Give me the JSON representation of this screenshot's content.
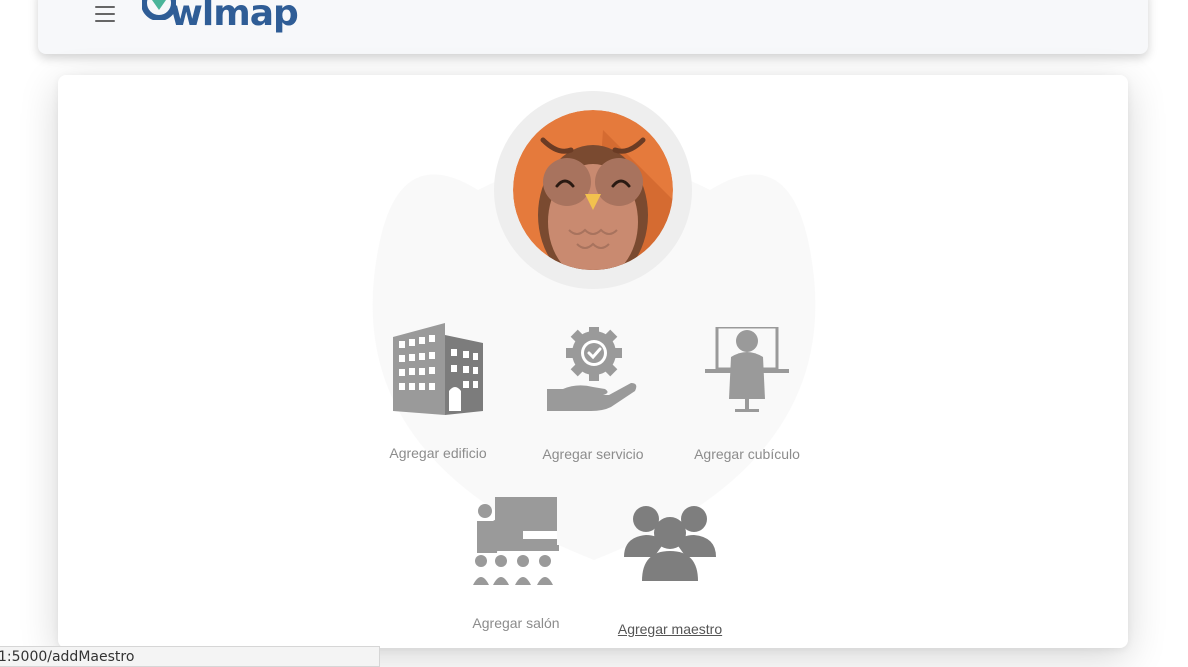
{
  "header": {
    "brand": "Owlmap",
    "menu_icon": "hamburger-icon"
  },
  "actions": [
    {
      "label": "Agregar edificio",
      "icon": "building-icon"
    },
    {
      "label": "Agregar servicio",
      "icon": "service-gear-hand-icon"
    },
    {
      "label": "Agregar cubículo",
      "icon": "cubicle-icon"
    },
    {
      "label": "Agregar salón",
      "icon": "classroom-icon"
    },
    {
      "label": "Agregar maestro",
      "icon": "teachers-group-icon"
    }
  ],
  "status_bar": {
    "url": "1:5000/addMaestro"
  },
  "colors": {
    "brand": "#2f5d96",
    "icon_gray": "#8e8e8e",
    "avatar_orange": "#e57a3c"
  }
}
